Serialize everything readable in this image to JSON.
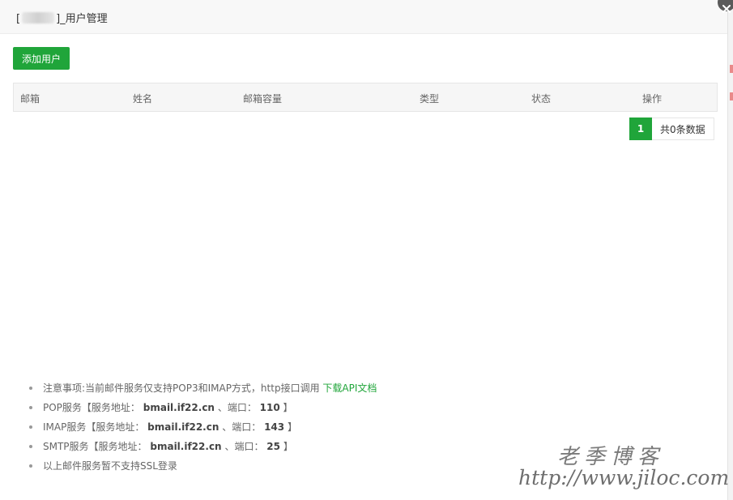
{
  "dialog": {
    "title_prefix": "[",
    "title_suffix": "]_用户管理"
  },
  "toolbar": {
    "add_label": "添加用户"
  },
  "table": {
    "columns": [
      "邮箱",
      "姓名",
      "邮箱容量",
      "类型",
      "状态",
      "操作"
    ],
    "rows": []
  },
  "pager": {
    "current": "1",
    "total_text": "共0条数据"
  },
  "notes": {
    "n1_text": "注意事项:当前邮件服务仅支持POP3和IMAP方式，http接口调用",
    "n1_link": "下载API文档",
    "pop": {
      "label": "POP服务【服务地址：",
      "host": "bmail.if22.cn",
      "port_label": "、端口：",
      "port": "110",
      "close": "】"
    },
    "imap": {
      "label": "IMAP服务【服务地址：",
      "host": "bmail.if22.cn",
      "port_label": "、端口：",
      "port": "143",
      "close": "】"
    },
    "smtp": {
      "label": "SMTP服务【服务地址：",
      "host": "bmail.if22.cn",
      "port_label": "、端口：",
      "port": "25",
      "close": "】"
    },
    "n5_text": "以上邮件服务暂不支持SSL登录"
  },
  "watermark": {
    "line1": "老季博客",
    "line2": "http://www.jiloc.com"
  },
  "colors": {
    "accent": "#20a53a",
    "header_bg": "#f8f8f8",
    "table_head_bg": "#f6f6f6",
    "backdrop_mark": "#e05050"
  }
}
